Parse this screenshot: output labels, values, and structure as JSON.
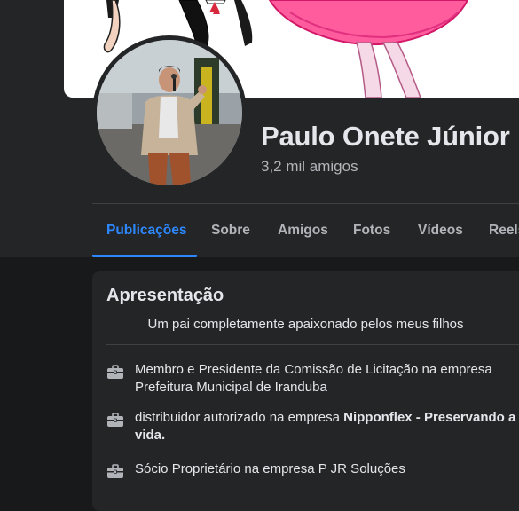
{
  "profile": {
    "name": "Paulo Onete Júnior",
    "friends_count": "3,2 mil amigos"
  },
  "tabs": [
    {
      "label": "Publicações",
      "active": true
    },
    {
      "label": "Sobre",
      "active": false
    },
    {
      "label": "Amigos",
      "active": false
    },
    {
      "label": "Fotos",
      "active": false
    },
    {
      "label": "Vídeos",
      "active": false
    },
    {
      "label": "Reels",
      "active": false
    }
  ],
  "intro": {
    "title": "Apresentação",
    "bio": "Um pai completamente apaixonado pelos meus filhos",
    "work": [
      {
        "prefix": "Membro e Presidente da Comissão de Licitação na empresa ",
        "company": "Prefeitura Municipal de Iranduba",
        "company_bold": false
      },
      {
        "prefix": "distribuidor autorizado na empresa ",
        "company": "Nipponflex - Preservando a vida.",
        "company_bold": true
      },
      {
        "prefix": "Sócio Proprietário na empresa ",
        "company": "P JR Soluções",
        "company_bold": false
      }
    ]
  },
  "colors": {
    "background": "#18191a",
    "surface": "#242526",
    "accent": "#2d88ff",
    "text_primary": "#e4e6eb",
    "text_secondary": "#b0b3b8",
    "icon": "work-briefcase-icon"
  }
}
